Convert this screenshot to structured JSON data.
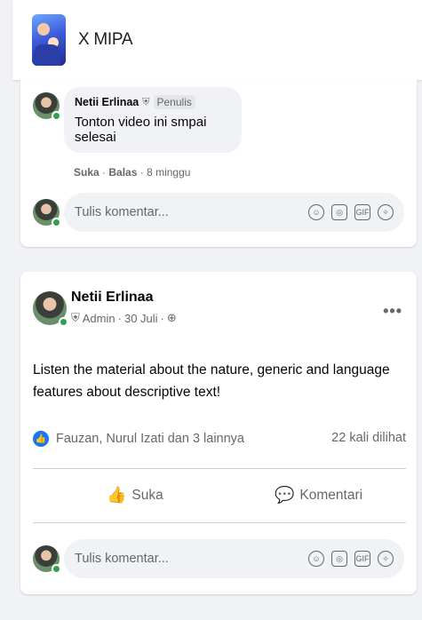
{
  "group": {
    "name": "X MIPA"
  },
  "comment": {
    "author": "Netii Erlinaa",
    "role": "Penulis",
    "text": "Tonton video ini smpai selesai",
    "like_label": "Suka",
    "reply_label": "Balas",
    "time": "8 minggu"
  },
  "comment_box": {
    "placeholder": "Tulis komentar..."
  },
  "post": {
    "author": "Netii Erlinaa",
    "role": "Admin",
    "date": "30 Juli",
    "text": "Listen the material about the nature, generic and language features about descriptive text!",
    "reactors": "Fauzan, Nurul Izati dan 3 lainnya",
    "views": "22 kali dilihat",
    "like_label": "Suka",
    "comment_label": "Komentari"
  },
  "icons": {
    "more": "more-options-icon",
    "shield": "shield-icon",
    "globe": "globe-icon",
    "like": "thumbs-up-icon",
    "comment": "comment-icon",
    "emoji": "emoji-icon",
    "camera": "camera-icon",
    "gif": "gif-icon",
    "sticker": "sticker-icon"
  },
  "colors": {
    "accent": "#1877f2",
    "online": "#31a24c"
  }
}
